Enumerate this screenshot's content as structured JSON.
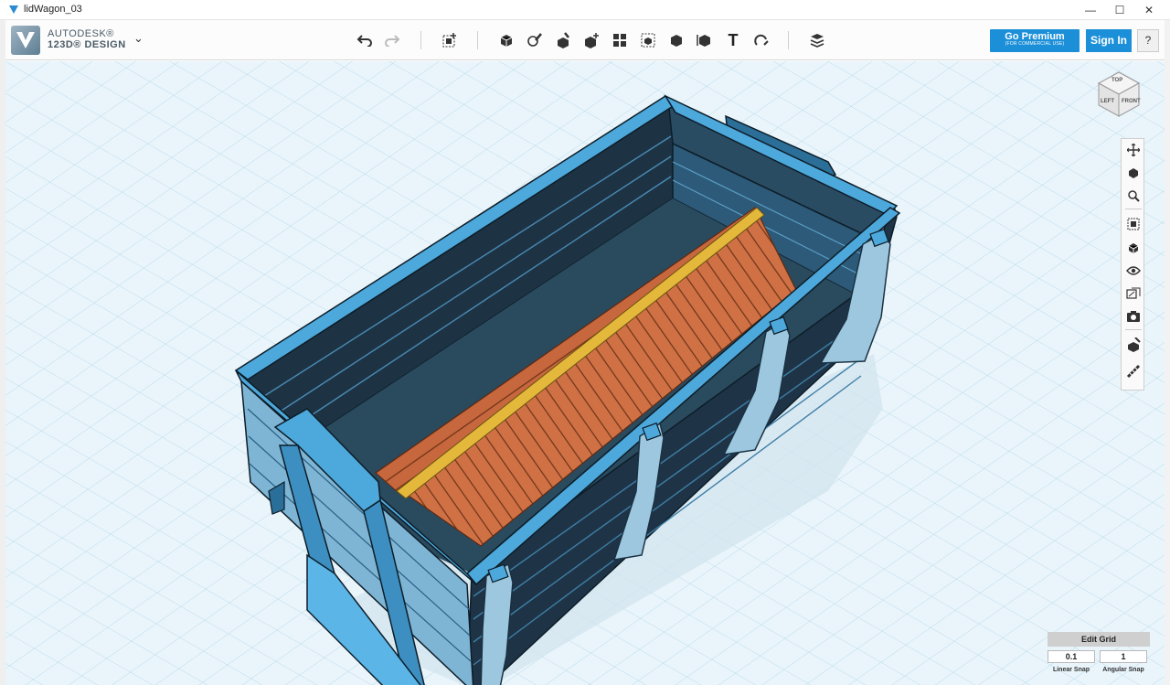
{
  "window": {
    "title": "lidWagon_03",
    "buttons": {
      "minimize": "—",
      "maximize": "☐",
      "close": "✕"
    }
  },
  "brand": {
    "line1": "AUTODESK®",
    "line2": "123D® DESIGN",
    "menu_chevron": "⌄"
  },
  "toolbar": {
    "icons": [
      "undo-icon",
      "redo-icon",
      "transform-icon",
      "primitives-icon",
      "sketch-icon",
      "construct-icon",
      "modify-icon",
      "pattern-icon",
      "grouping-icon",
      "combine-icon",
      "measure-icon",
      "text-icon",
      "snap-icon",
      "material-icon"
    ],
    "text_tool_glyph": "T",
    "premium_label": "Go Premium",
    "premium_sub": "(FOR COMMERCIAL USE)",
    "signin_label": "Sign In",
    "help_label": "?"
  },
  "viewcube": {
    "top": "TOP",
    "left": "LEFT",
    "front": "FRONT"
  },
  "navbar": {
    "items": [
      "pan-icon",
      "orbit-icon",
      "zoom-icon",
      "fit-icon",
      "views-icon",
      "visibility-icon",
      "materials-icon",
      "screenshot-icon",
      "snap-tool-icon",
      "ruler-icon"
    ]
  },
  "grid": {
    "edit_label": "Edit Grid",
    "linear_value": "0.1",
    "angular_value": "1",
    "linear_label": "Linear Snap",
    "angular_label": "Angular Snap"
  },
  "colors": {
    "viewport_bg": "#eaf5fb",
    "grid_line": "#b7d9ea",
    "wagon_light": "#4da8db",
    "wagon_mid": "#2a6f99",
    "wagon_dark": "#1e3446",
    "load_orange": "#c7673d",
    "load_stripe": "#e4b83a",
    "accent_blue": "#1b8fd8"
  }
}
